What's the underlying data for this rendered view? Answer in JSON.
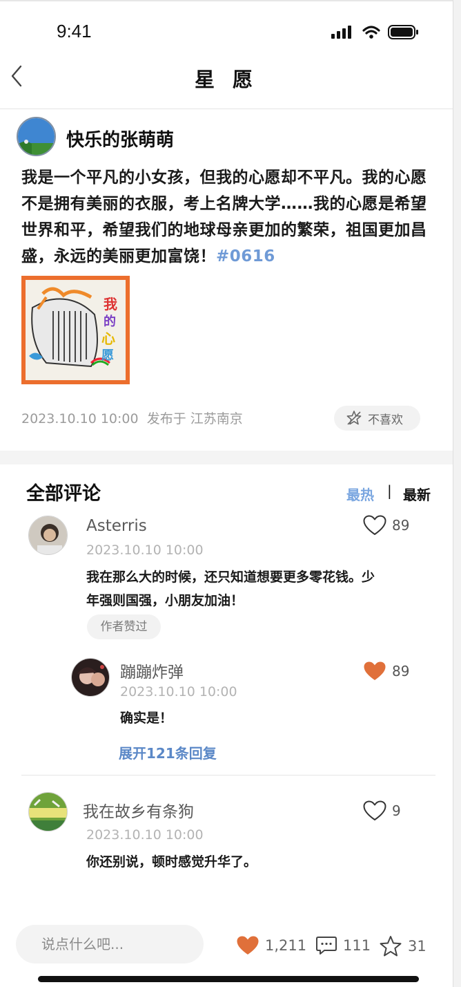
{
  "status_bar": {
    "time": "9:41"
  },
  "nav": {
    "title": "星 愿"
  },
  "post": {
    "author": "快乐的张萌萌",
    "text": "我是一个平凡的小女孩，但我的心愿却不平凡。我的心愿不是拥有美丽的衣服，考上名牌大学……我的心愿是希望世界和平，希望我们的地球母亲更加的繁荣，祖国更加昌盛，永远的美丽更加富饶！",
    "hashtag": "#0616",
    "image_caption_chars": [
      "我",
      "的",
      "心",
      "愿"
    ],
    "timestamp": "2023.10.10 10:00",
    "location": "发布于 江苏南京",
    "dislike_label": "不喜欢"
  },
  "comments_section": {
    "title": "全部评论",
    "sort_hot": "最热",
    "sort_separator": "|",
    "sort_new": "最新",
    "comments": [
      {
        "name": "Asterris",
        "time": "2023.10.10 10:00",
        "text_line1": "我在那么大的时候，还只知道想要更多零花钱。少",
        "text_line2": "年强则国强，小朋友加油！",
        "likes": "89",
        "liked": false,
        "badge": "作者赞过",
        "reply": {
          "name": "蹦蹦炸弹",
          "time": "2023.10.10 10:00",
          "text": "确实是！",
          "likes": "89",
          "liked": true
        },
        "expand_label": "展开121条回复"
      },
      {
        "name": "我在故乡有条狗",
        "time": "2023.10.10 10:00",
        "text": "你还别说，顿时感觉升华了。",
        "likes": "9",
        "liked": false
      }
    ]
  },
  "bottom_bar": {
    "input_placeholder": "说点什么吧...",
    "likes": "1,211",
    "comments": "111",
    "favorites": "31"
  },
  "colors": {
    "accent_orange": "#e0703a",
    "link_blue": "#5b88c7",
    "hashtag_blue": "#6f9ad6",
    "sort_hot_blue": "#7aa6e0"
  }
}
